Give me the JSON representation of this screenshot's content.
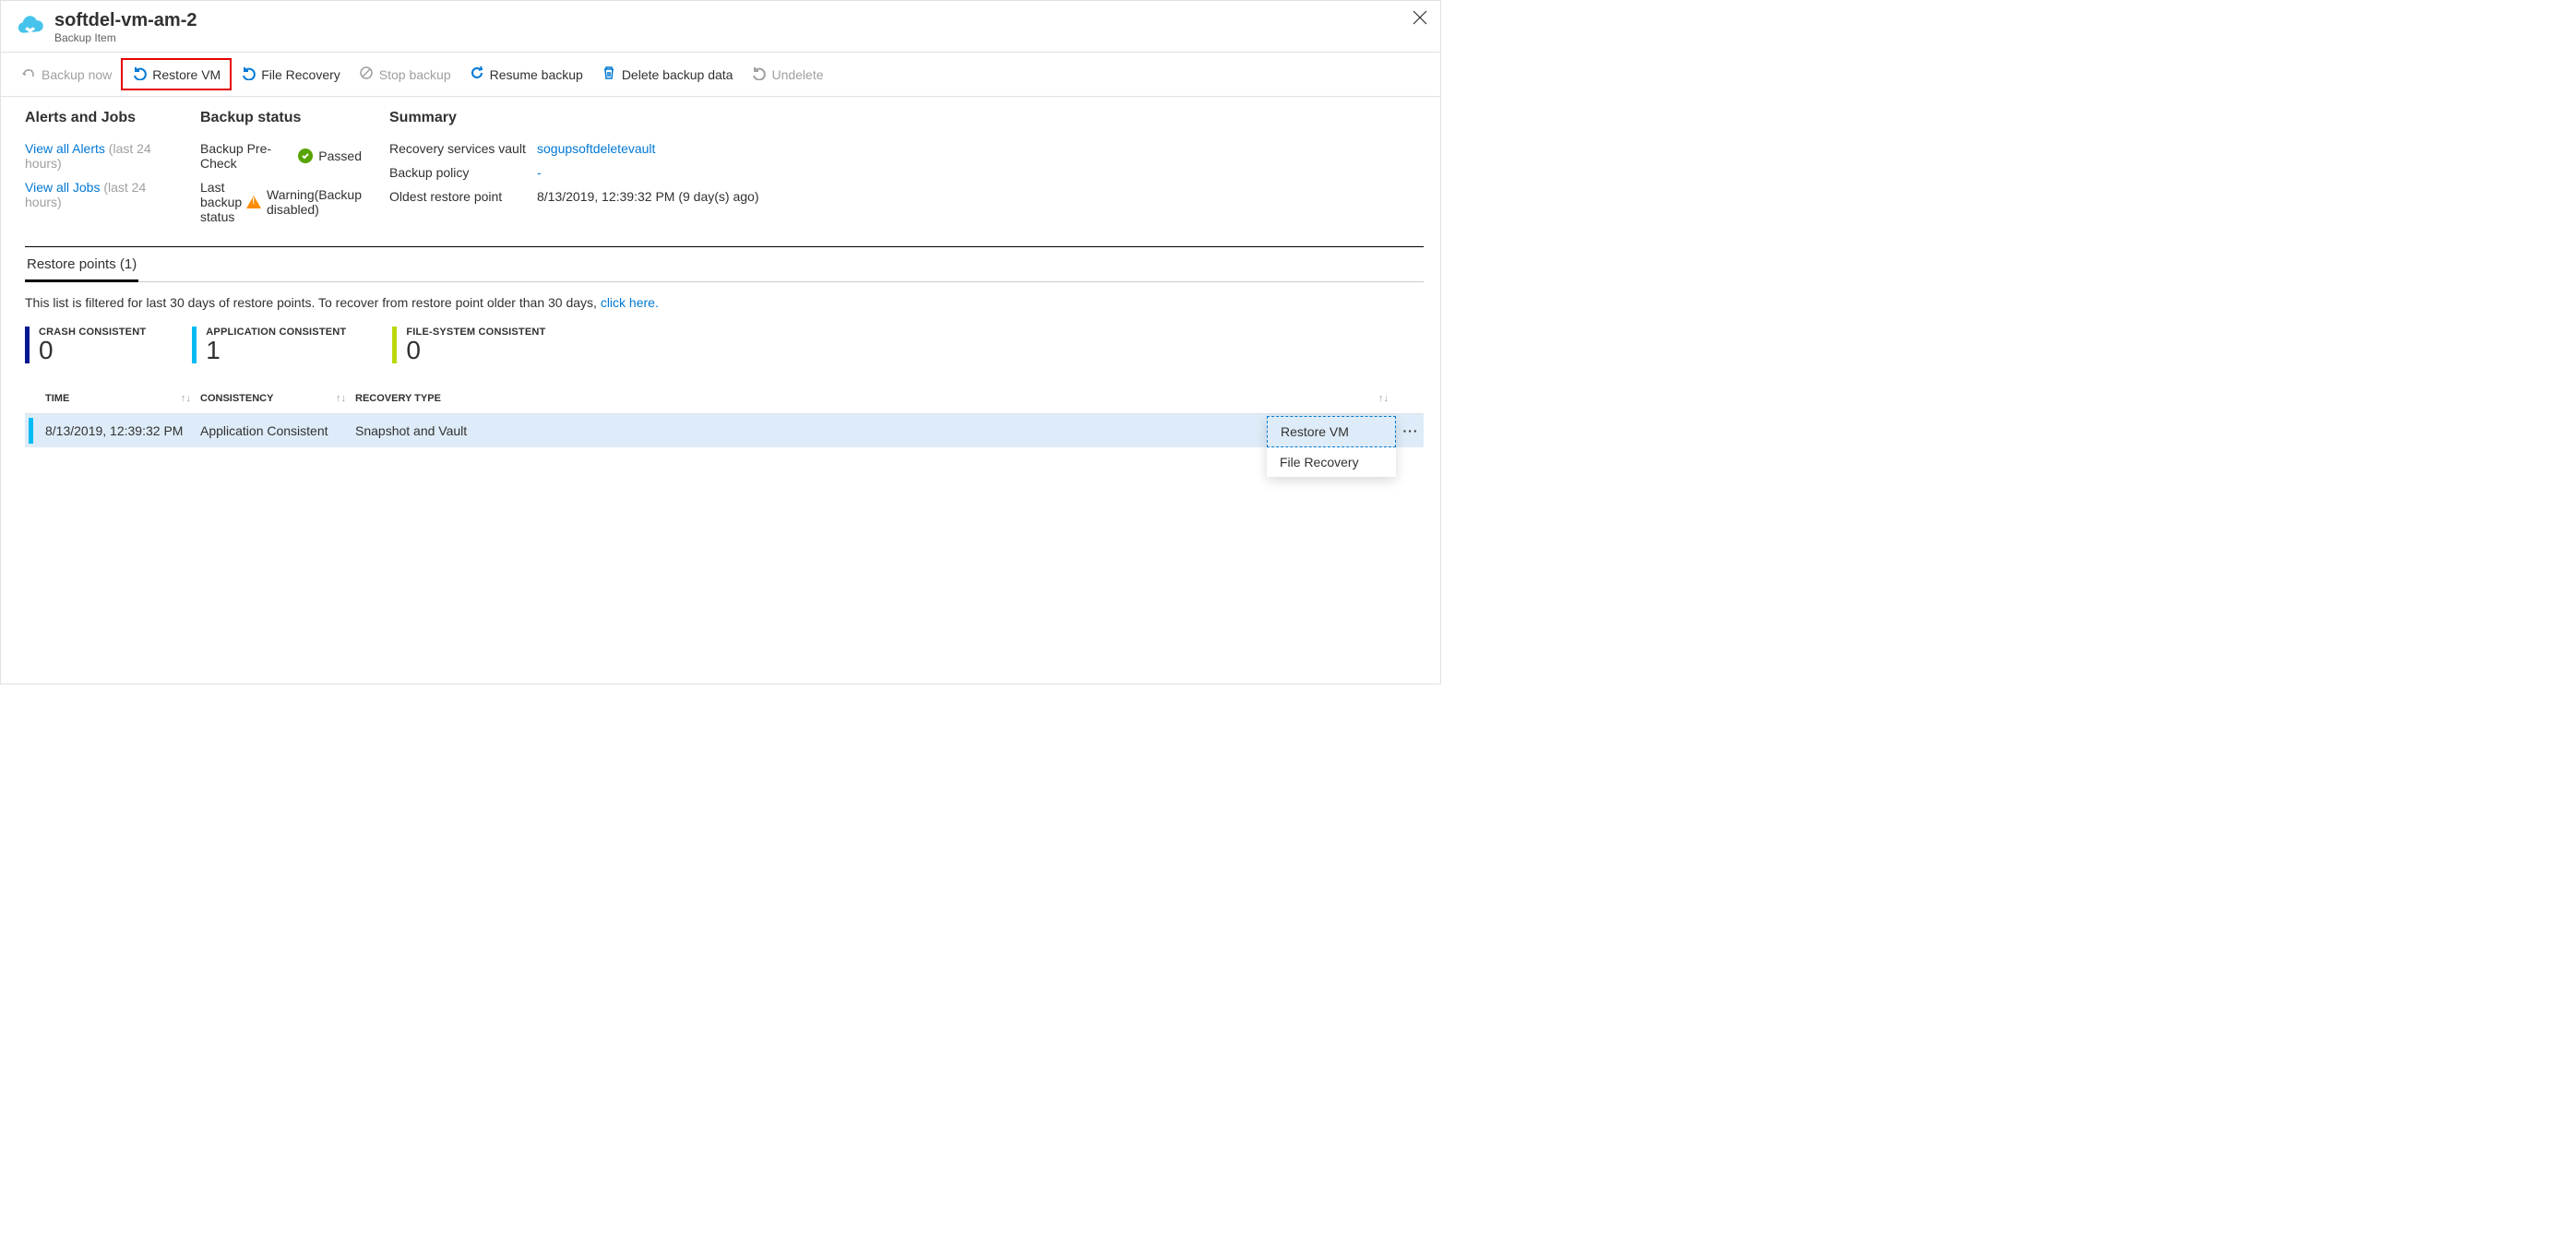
{
  "header": {
    "title": "softdel-vm-am-2",
    "subtitle": "Backup Item"
  },
  "toolbar": {
    "backup_now": "Backup now",
    "restore_vm": "Restore VM",
    "file_recovery": "File Recovery",
    "stop_backup": "Stop backup",
    "resume_backup": "Resume backup",
    "delete_backup_data": "Delete backup data",
    "undelete": "Undelete"
  },
  "alerts": {
    "title": "Alerts and Jobs",
    "view_alerts": "View all Alerts",
    "alerts_hint": "(last 24 hours)",
    "view_jobs": "View all Jobs",
    "jobs_hint": "(last 24 hours)"
  },
  "backup_status": {
    "title": "Backup status",
    "precheck_label": "Backup Pre-Check",
    "precheck_value": "Passed",
    "last_label": "Last backup status",
    "last_value": "Warning(Backup disabled)"
  },
  "summary": {
    "title": "Summary",
    "vault_label": "Recovery services vault",
    "vault_value": "sogupsoftdeletevault",
    "policy_label": "Backup policy",
    "policy_value": "-",
    "oldest_label": "Oldest restore point",
    "oldest_value": "8/13/2019, 12:39:32 PM (9 day(s) ago)"
  },
  "tabs": {
    "restore_points": "Restore points (1)"
  },
  "filter_note": {
    "text": "This list is filtered for last 30 days of restore points. To recover from restore point older than 30 days, ",
    "link": "click here."
  },
  "stats": {
    "crash_label": "CRASH CONSISTENT",
    "crash_value": "0",
    "app_label": "APPLICATION CONSISTENT",
    "app_value": "1",
    "fs_label": "FILE-SYSTEM CONSISTENT",
    "fs_value": "0"
  },
  "table": {
    "hdr_time": "TIME",
    "hdr_cons": "CONSISTENCY",
    "hdr_rec": "RECOVERY TYPE",
    "row0": {
      "time": "8/13/2019, 12:39:32 PM",
      "cons": "Application Consistent",
      "rec": "Snapshot and Vault"
    }
  },
  "context": {
    "restore_vm": "Restore VM",
    "file_recovery": "File Recovery"
  }
}
